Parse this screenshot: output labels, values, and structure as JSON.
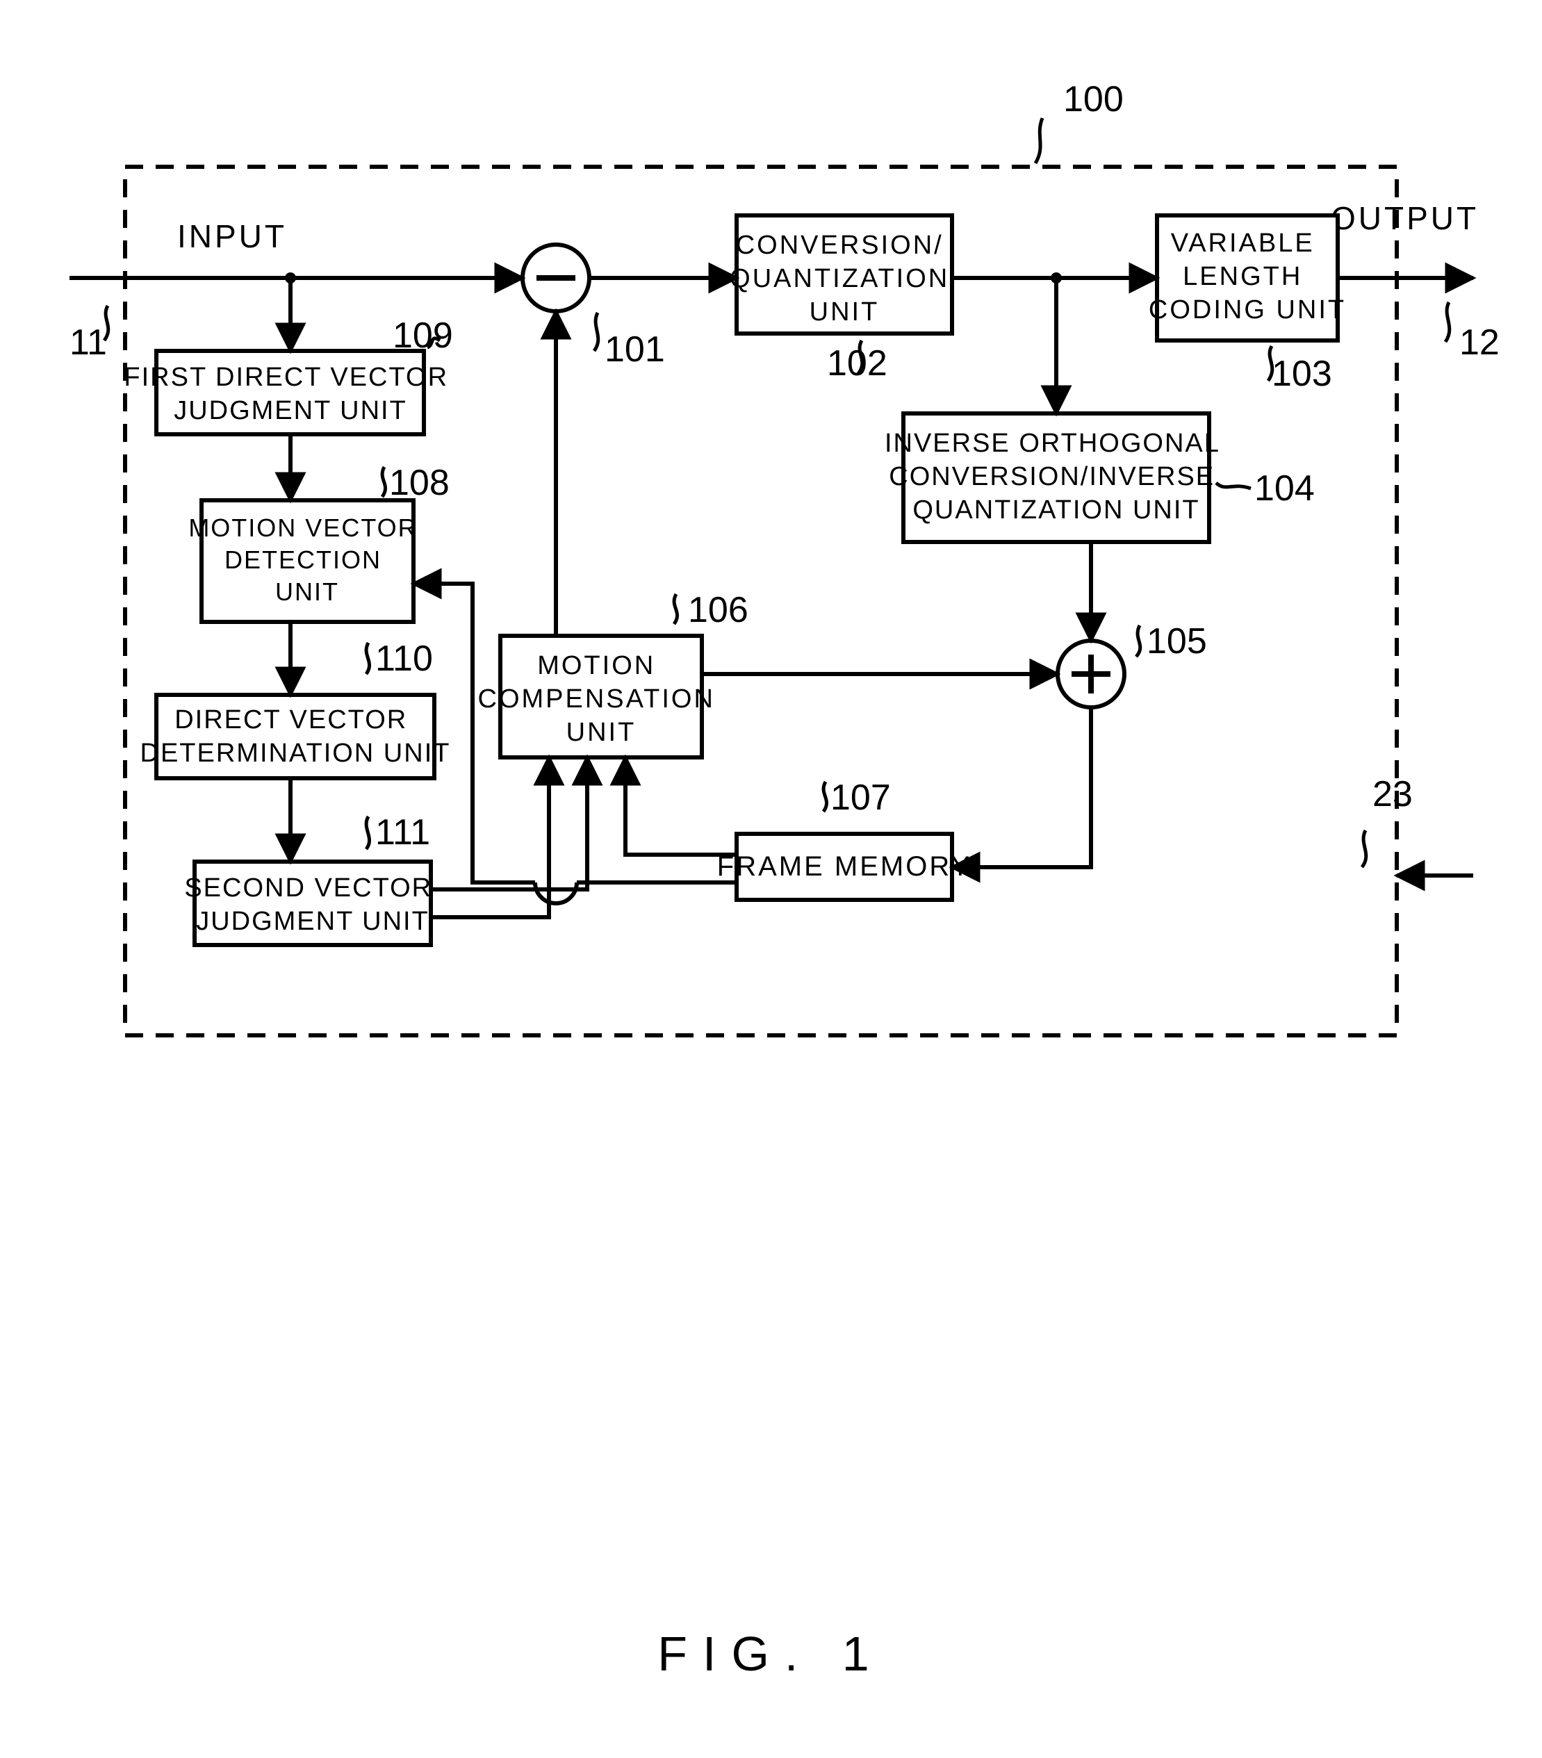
{
  "labels": {
    "input": "INPUT",
    "output": "OUTPUT",
    "fig": "FIG. 1"
  },
  "ref": {
    "system": "100",
    "in": "11",
    "out": "12",
    "subtractor": "101",
    "convq": "102",
    "vlc": "103",
    "inv": "104",
    "adder": "105",
    "mc": "106",
    "fm": "107",
    "mvd": "108",
    "fdv": "109",
    "dvd": "110",
    "sv": "111",
    "ext": "23"
  },
  "blocks": {
    "convq": "CONVERSION/\nQUANTIZATION\nUNIT",
    "vlc": "VARIABLE\nLENGTH\nCODING UNIT",
    "inv": "INVERSE ORTHOGONAL\nCONVERSION/INVERSE\nQUANTIZATION UNIT",
    "mc": "MOTION\nCOMPENSATION\nUNIT",
    "fm": "FRAME MEMORY",
    "mvd": "MOTION VECTOR\nDETECTION\nUNIT",
    "fdv": "FIRST DIRECT VECTOR\nJUDGMENT UNIT",
    "dvd": "DIRECT VECTOR\nDETERMINATION UNIT",
    "sv": "SECOND VECTOR\nJUDGMENT UNIT"
  }
}
